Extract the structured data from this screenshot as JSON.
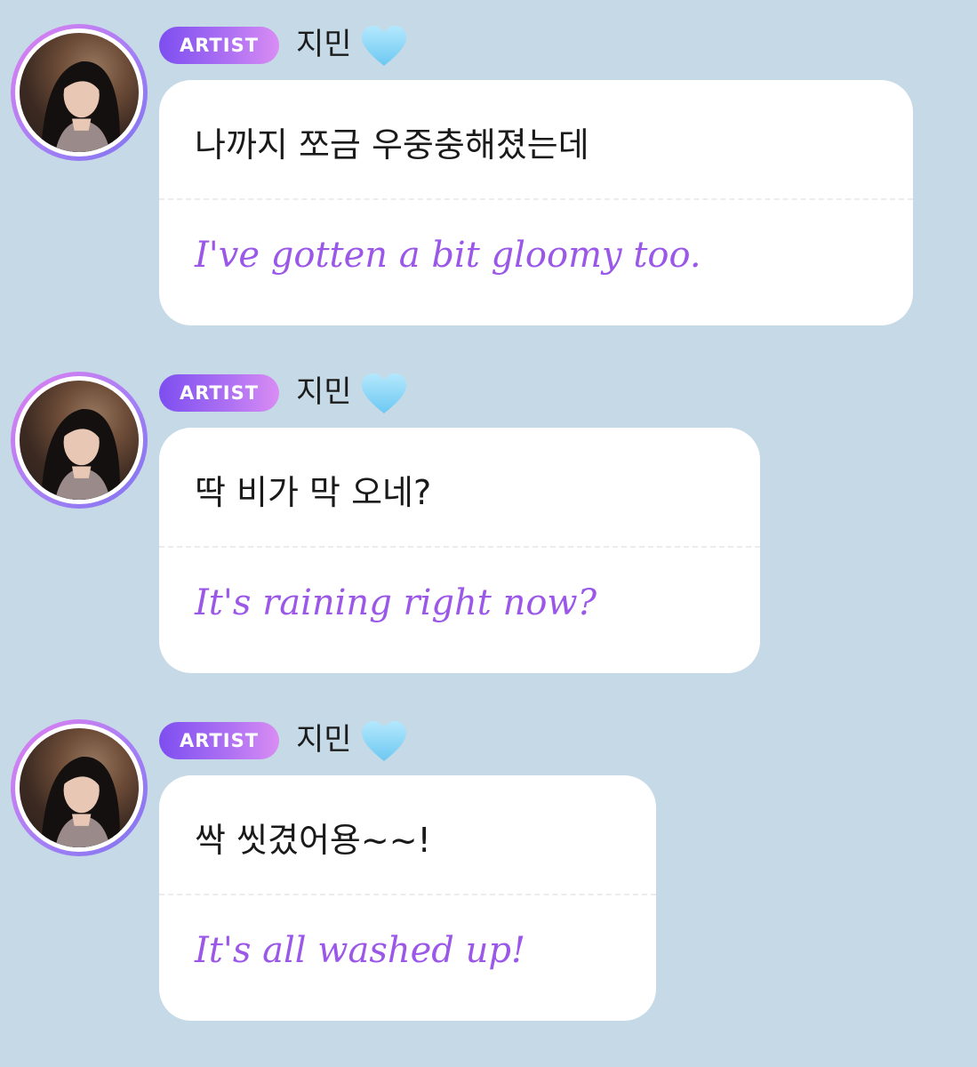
{
  "chat": {
    "messages": [
      {
        "badge": "ARTIST",
        "sender": "지민",
        "heart_icon": "light-blue-heart-emoji",
        "korean": "나까지 쪼금 우중충해졌는데",
        "english": "I've gotten a bit gloomy too."
      },
      {
        "badge": "ARTIST",
        "sender": "지민",
        "heart_icon": "light-blue-heart-emoji",
        "korean": "딱 비가 막 오네?",
        "english": "It's raining right now?"
      },
      {
        "badge": "ARTIST",
        "sender": "지민",
        "heart_icon": "light-blue-heart-emoji",
        "korean": "싹 씻겼어용~~!",
        "english": "It's all washed up!"
      }
    ]
  },
  "colors": {
    "background": "#c6d9e6",
    "bubble": "#ffffff",
    "translation_text": "#9a57e8",
    "badge_start": "#7d4ef0",
    "badge_end": "#d98cf3",
    "heart": "#8fd8f8"
  }
}
